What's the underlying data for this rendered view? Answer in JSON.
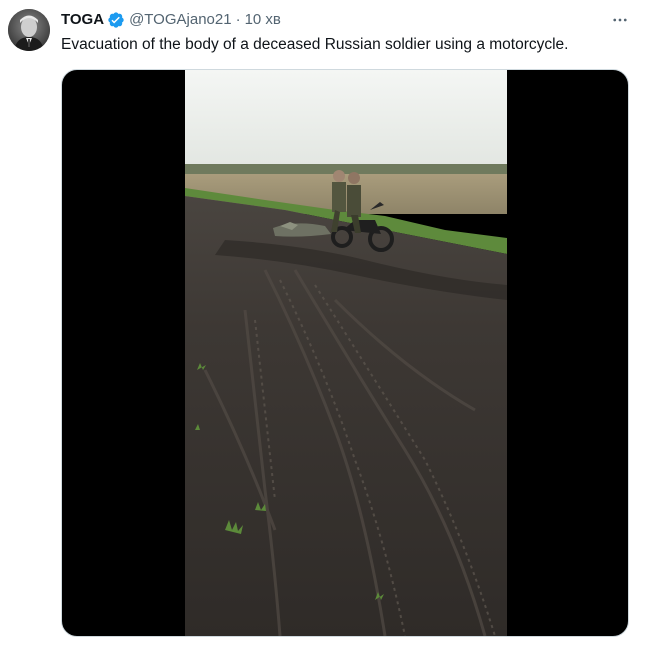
{
  "tweet": {
    "display_name": "TOGA",
    "verified": true,
    "handle": "@TOGAjano21",
    "separator": "·",
    "time": "10 хв",
    "text": "Evacuation of the body of a deceased Russian soldier using a motorcycle.",
    "avatar_icon": "user-avatar-portrait",
    "verified_icon": "verified-badge-icon",
    "more_icon": "more-dots-icon",
    "accent_color": "#1d9bf0"
  },
  "media": {
    "type": "video-frame",
    "scene_icon": "video-frame-field-road-motorcycle"
  }
}
